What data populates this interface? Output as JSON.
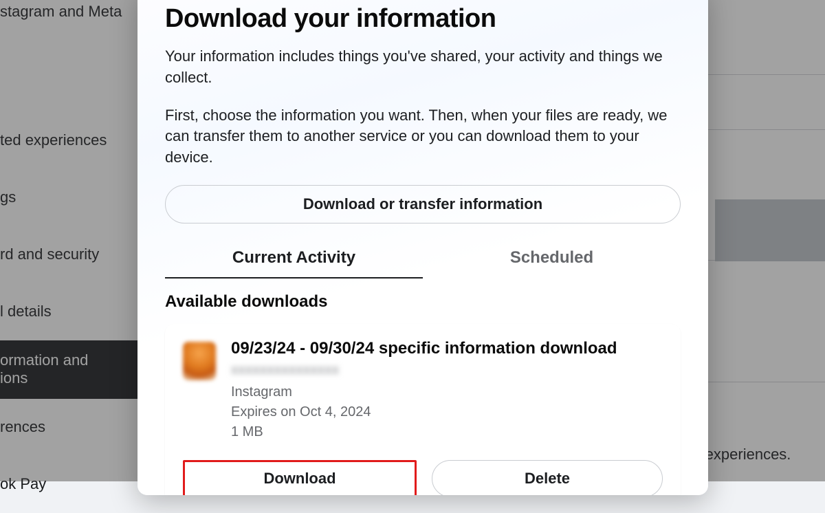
{
  "background": {
    "sidebar_items": [
      "stagram and Meta",
      "ted experiences",
      "gs",
      "rd and security",
      "l details",
      "ormation and\nions",
      "rences",
      "ok Pay"
    ],
    "selected_index": 5,
    "right_text": "ur experiences."
  },
  "modal": {
    "title": "Download your information",
    "lead1": "Your information includes things you've shared, your activity and things we collect.",
    "lead2": "First, choose the information you want. Then, when your files are ready, we can transfer them to another service or you can download them to your device.",
    "primary_button": "Download or transfer information",
    "tabs": {
      "active": "Current Activity",
      "inactive": "Scheduled"
    },
    "section_label": "Available downloads",
    "download_item": {
      "title": "09/23/24 - 09/30/24 specific information download",
      "username_blurred": "xxxxxxxxxxxxxxx",
      "service": "Instagram",
      "expiry": "Expires on Oct 4, 2024",
      "size": "1 MB",
      "actions": {
        "download": "Download",
        "delete": "Delete"
      }
    }
  }
}
